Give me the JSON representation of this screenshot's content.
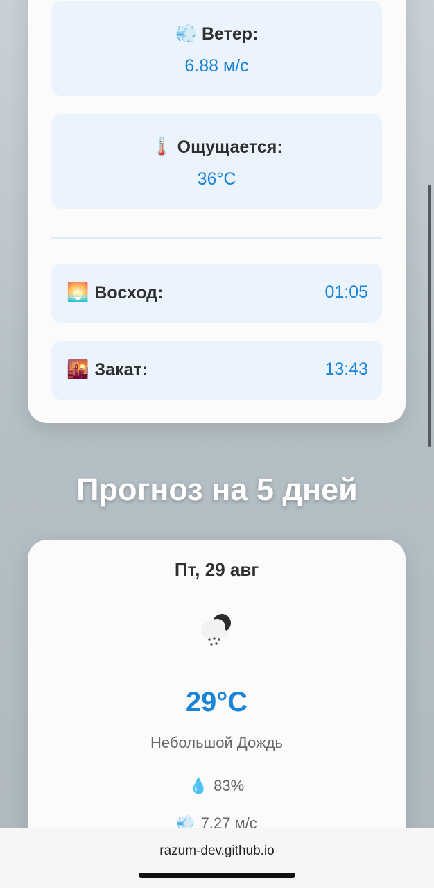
{
  "current": {
    "wind": {
      "icon": "💨",
      "label": "Ветер:",
      "value": "6.88 м/с"
    },
    "feels_like": {
      "icon": "🌡️",
      "label": "Ощущается:",
      "value": "36°C"
    },
    "sunrise": {
      "icon": "🌅",
      "label": "Восход:",
      "value": "01:05"
    },
    "sunset": {
      "icon": "🌇",
      "label": "Закат:",
      "value": "13:43"
    }
  },
  "forecast": {
    "title": "Прогноз на 5 дней",
    "days": [
      {
        "date": "Пт, 29 авг",
        "icon_name": "rain-cloud-icon",
        "temp": "29°C",
        "description": "Небольшой Дождь",
        "humidity_icon": "💧",
        "humidity": "83%",
        "wind_icon": "💨",
        "wind": "7.27 м/с"
      }
    ]
  },
  "browser": {
    "url": "razum-dev.github.io"
  }
}
